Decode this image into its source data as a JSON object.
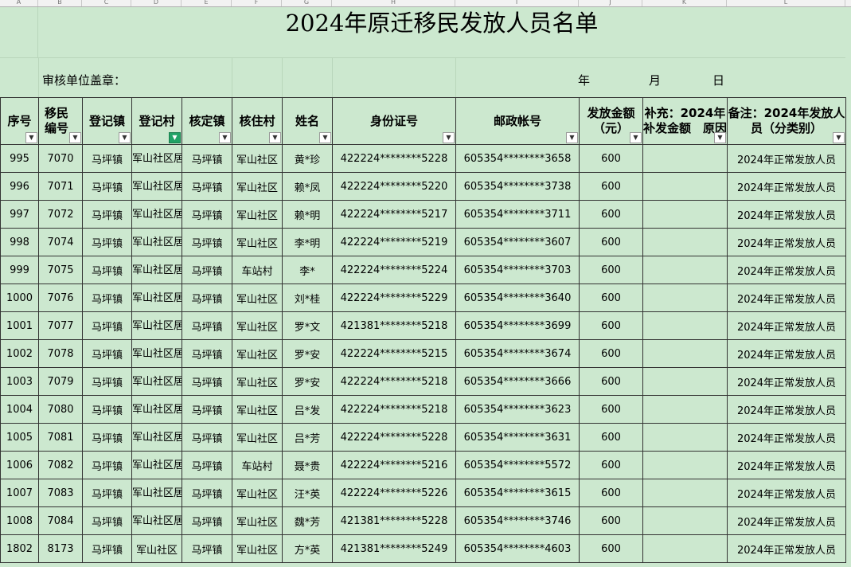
{
  "column_letters": [
    "A",
    "B",
    "C",
    "D",
    "E",
    "F",
    "G",
    "H",
    "I",
    "J",
    "K",
    "L"
  ],
  "title": "2024年原迁移民发放人员名单",
  "stamp_label": "审核单位盖章：",
  "date": {
    "year": "年",
    "month": "月",
    "day": "日"
  },
  "headers": [
    {
      "label": "序号",
      "filter_active": false
    },
    {
      "label": "移民编号",
      "filter_active": false
    },
    {
      "label": "登记镇",
      "filter_active": false
    },
    {
      "label": "登记村",
      "filter_active": true
    },
    {
      "label": "核定镇",
      "filter_active": false
    },
    {
      "label": "核住村",
      "filter_active": false
    },
    {
      "label": "姓名",
      "filter_active": false
    },
    {
      "label": "身份证号",
      "filter_active": false
    },
    {
      "label": "邮政帐号",
      "filter_active": false
    },
    {
      "label": "发放金额（元）",
      "filter_active": false
    },
    {
      "label": "补充：2024年补发金额　原因",
      "filter_active": false
    },
    {
      "label": "备注：2024年发放人员（分类别）",
      "filter_active": false
    }
  ],
  "filter_icon": "dropdown-arrow-icon",
  "filter_active_icon": "funnel-icon",
  "filter_active_color": "#21a366",
  "rows": [
    {
      "seq": "995",
      "code": "7070",
      "reg_town": "马坪镇",
      "reg_village": "军山社区居委会",
      "town": "马坪镇",
      "village": "军山社区",
      "name": "黄*珍",
      "id": "422224********5228",
      "account": "605354********3658",
      "amount": "600",
      "supplement": "",
      "note": "2024年正常发放人员"
    },
    {
      "seq": "996",
      "code": "7071",
      "reg_town": "马坪镇",
      "reg_village": "军山社区居委会",
      "town": "马坪镇",
      "village": "军山社区",
      "name": "赖*凤",
      "id": "422224********5220",
      "account": "605354********3738",
      "amount": "600",
      "supplement": "",
      "note": "2024年正常发放人员"
    },
    {
      "seq": "997",
      "code": "7072",
      "reg_town": "马坪镇",
      "reg_village": "军山社区居委会",
      "town": "马坪镇",
      "village": "军山社区",
      "name": "赖*明",
      "id": "422224********5217",
      "account": "605354********3711",
      "amount": "600",
      "supplement": "",
      "note": "2024年正常发放人员"
    },
    {
      "seq": "998",
      "code": "7074",
      "reg_town": "马坪镇",
      "reg_village": "军山社区居委会",
      "town": "马坪镇",
      "village": "军山社区",
      "name": "李*明",
      "id": "422224********5219",
      "account": "605354********3607",
      "amount": "600",
      "supplement": "",
      "note": "2024年正常发放人员"
    },
    {
      "seq": "999",
      "code": "7075",
      "reg_town": "马坪镇",
      "reg_village": "军山社区居委会",
      "town": "马坪镇",
      "village": "车站村",
      "name": "李*",
      "id": "422224********5224",
      "account": "605354********3703",
      "amount": "600",
      "supplement": "",
      "note": "2024年正常发放人员"
    },
    {
      "seq": "1000",
      "code": "7076",
      "reg_town": "马坪镇",
      "reg_village": "军山社区居委会",
      "town": "马坪镇",
      "village": "军山社区",
      "name": "刘*桂",
      "id": "422224********5229",
      "account": "605354********3640",
      "amount": "600",
      "supplement": "",
      "note": "2024年正常发放人员"
    },
    {
      "seq": "1001",
      "code": "7077",
      "reg_town": "马坪镇",
      "reg_village": "军山社区居委会",
      "town": "马坪镇",
      "village": "军山社区",
      "name": "罗*文",
      "id": "421381********5218",
      "account": "605354********3699",
      "amount": "600",
      "supplement": "",
      "note": "2024年正常发放人员"
    },
    {
      "seq": "1002",
      "code": "7078",
      "reg_town": "马坪镇",
      "reg_village": "军山社区居委会",
      "town": "马坪镇",
      "village": "军山社区",
      "name": "罗*安",
      "id": "422224********5215",
      "account": "605354********3674",
      "amount": "600",
      "supplement": "",
      "note": "2024年正常发放人员"
    },
    {
      "seq": "1003",
      "code": "7079",
      "reg_town": "马坪镇",
      "reg_village": "军山社区居委会",
      "town": "马坪镇",
      "village": "军山社区",
      "name": "罗*安",
      "id": "422224********5218",
      "account": "605354********3666",
      "amount": "600",
      "supplement": "",
      "note": "2024年正常发放人员"
    },
    {
      "seq": "1004",
      "code": "7080",
      "reg_town": "马坪镇",
      "reg_village": "军山社区居委会",
      "town": "马坪镇",
      "village": "军山社区",
      "name": "吕*发",
      "id": "422224********5218",
      "account": "605354********3623",
      "amount": "600",
      "supplement": "",
      "note": "2024年正常发放人员"
    },
    {
      "seq": "1005",
      "code": "7081",
      "reg_town": "马坪镇",
      "reg_village": "军山社区居委会",
      "town": "马坪镇",
      "village": "军山社区",
      "name": "吕*芳",
      "id": "422224********5228",
      "account": "605354********3631",
      "amount": "600",
      "supplement": "",
      "note": "2024年正常发放人员"
    },
    {
      "seq": "1006",
      "code": "7082",
      "reg_town": "马坪镇",
      "reg_village": "军山社区居委会",
      "town": "马坪镇",
      "village": "车站村",
      "name": "聂*贵",
      "id": "422224********5216",
      "account": "605354********5572",
      "amount": "600",
      "supplement": "",
      "note": "2024年正常发放人员"
    },
    {
      "seq": "1007",
      "code": "7083",
      "reg_town": "马坪镇",
      "reg_village": "军山社区居委会",
      "town": "马坪镇",
      "village": "军山社区",
      "name": "汪*英",
      "id": "422224********5226",
      "account": "605354********3615",
      "amount": "600",
      "supplement": "",
      "note": "2024年正常发放人员"
    },
    {
      "seq": "1008",
      "code": "7084",
      "reg_town": "马坪镇",
      "reg_village": "军山社区居委会",
      "town": "马坪镇",
      "village": "军山社区",
      "name": "魏*芳",
      "id": "421381********5228",
      "account": "605354********3746",
      "amount": "600",
      "supplement": "",
      "note": "2024年正常发放人员"
    },
    {
      "seq": "1802",
      "code": "8173",
      "reg_town": "马坪镇",
      "reg_village": "军山社区",
      "town": "马坪镇",
      "village": "军山社区",
      "name": "方*英",
      "id": "421381********5249",
      "account": "605354********4603",
      "amount": "600",
      "supplement": "",
      "note": "2024年正常发放人员"
    }
  ]
}
